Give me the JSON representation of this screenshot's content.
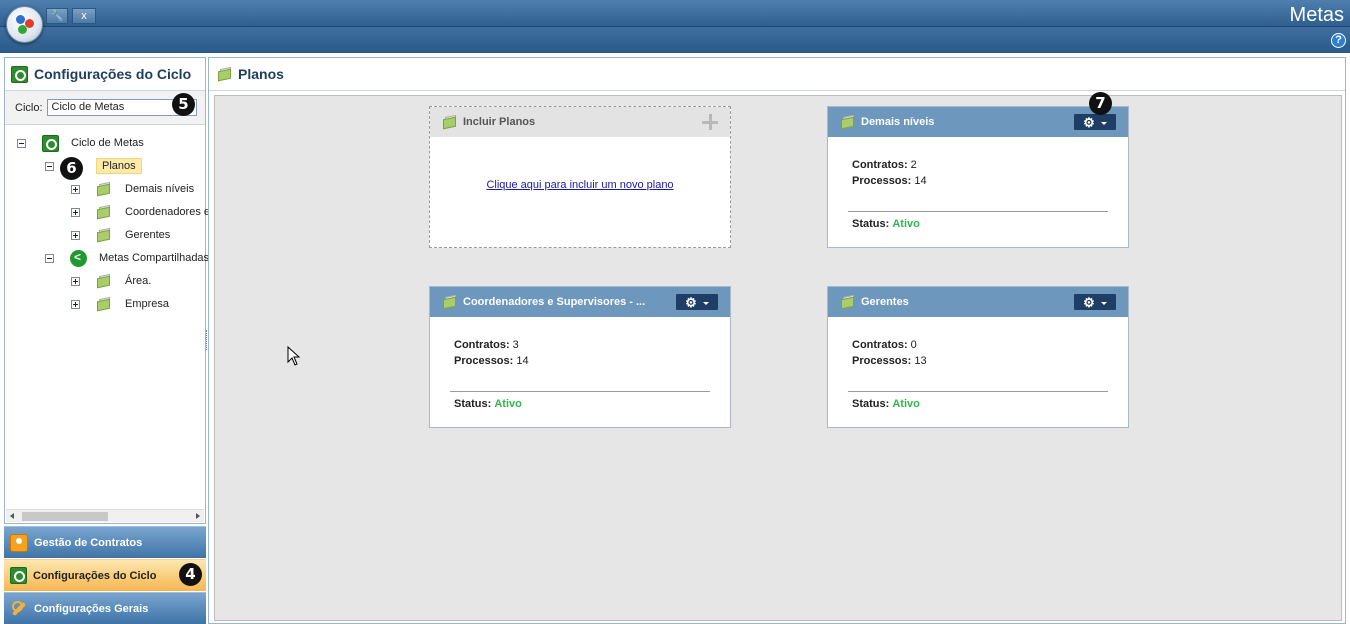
{
  "app": {
    "title": "Metas",
    "quick_buttons": [
      "🔧",
      "x"
    ],
    "help": "?"
  },
  "sidebar": {
    "title": "Configurações do Ciclo",
    "ciclo_label": "Ciclo:",
    "ciclo_value": "Ciclo de Metas",
    "tree": {
      "root": "Ciclo de Metas",
      "planos": "Planos",
      "planos_children": [
        "Demais níveis",
        "Coordenadores e",
        "Gerentes"
      ],
      "metas_compartilhadas": "Metas Compartilhadas",
      "metas_children": [
        "Área.",
        "Empresa"
      ]
    }
  },
  "accordion": {
    "gestao": "Gestão de Contratos",
    "configuracoes_ciclo": "Configurações do Ciclo",
    "configuracoes_gerais": "Configurações Gerais"
  },
  "main": {
    "title": "Planos",
    "add_card": {
      "title": "Incluir Planos",
      "link": "Clique aqui para incluir um novo plano"
    },
    "cards": [
      {
        "title": "Demais níveis",
        "contratos": "2",
        "processos": "14",
        "status": "Ativo"
      },
      {
        "title": "Coordenadores e Supervisores - ...",
        "contratos": "3",
        "processos": "14",
        "status": "Ativo"
      },
      {
        "title": "Gerentes",
        "contratos": "0",
        "processos": "13",
        "status": "Ativo"
      }
    ],
    "labels": {
      "contratos": "Contratos:",
      "processos": "Processos:",
      "status": "Status:"
    }
  },
  "callouts": [
    "5",
    "6",
    "7",
    "4"
  ],
  "colors": {
    "accent": "#6d97bd",
    "active_status": "#2fb84a",
    "header_bar": "#2f5f8f"
  }
}
